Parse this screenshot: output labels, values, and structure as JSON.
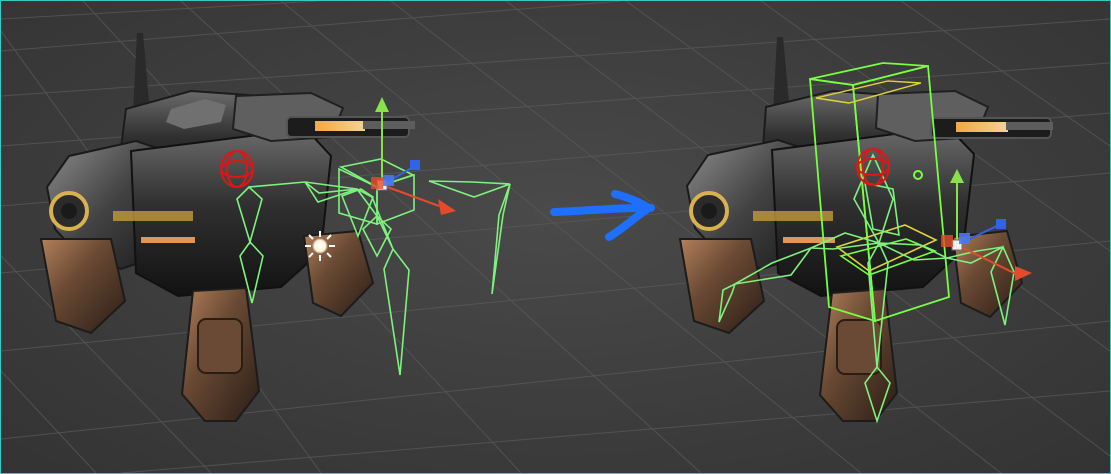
{
  "scene": {
    "background_color": "#3f3f3f",
    "grid_color": "#5a5a5a",
    "border_color": "#37c9c4",
    "before_panel": {
      "subject": "mech-robot",
      "bone_color": "#7df27d",
      "gizmo_colors": {
        "x": "#e34b2b",
        "y": "#87e24b",
        "z": "#2f63e8",
        "rotation": "#e01515",
        "light": "#ffffff"
      }
    },
    "after_panel": {
      "subject": "mech-robot",
      "bone_color": "#7df27d",
      "collider_color": "#78ff3f",
      "selection_color": "#e0d43a",
      "gizmo_colors": {
        "x": "#e34b2b",
        "y": "#87e24b",
        "z": "#2f63e8",
        "rotation": "#e01515"
      }
    },
    "transition": {
      "icon": "arrow-right-icon",
      "color": "#1f6fff"
    }
  }
}
